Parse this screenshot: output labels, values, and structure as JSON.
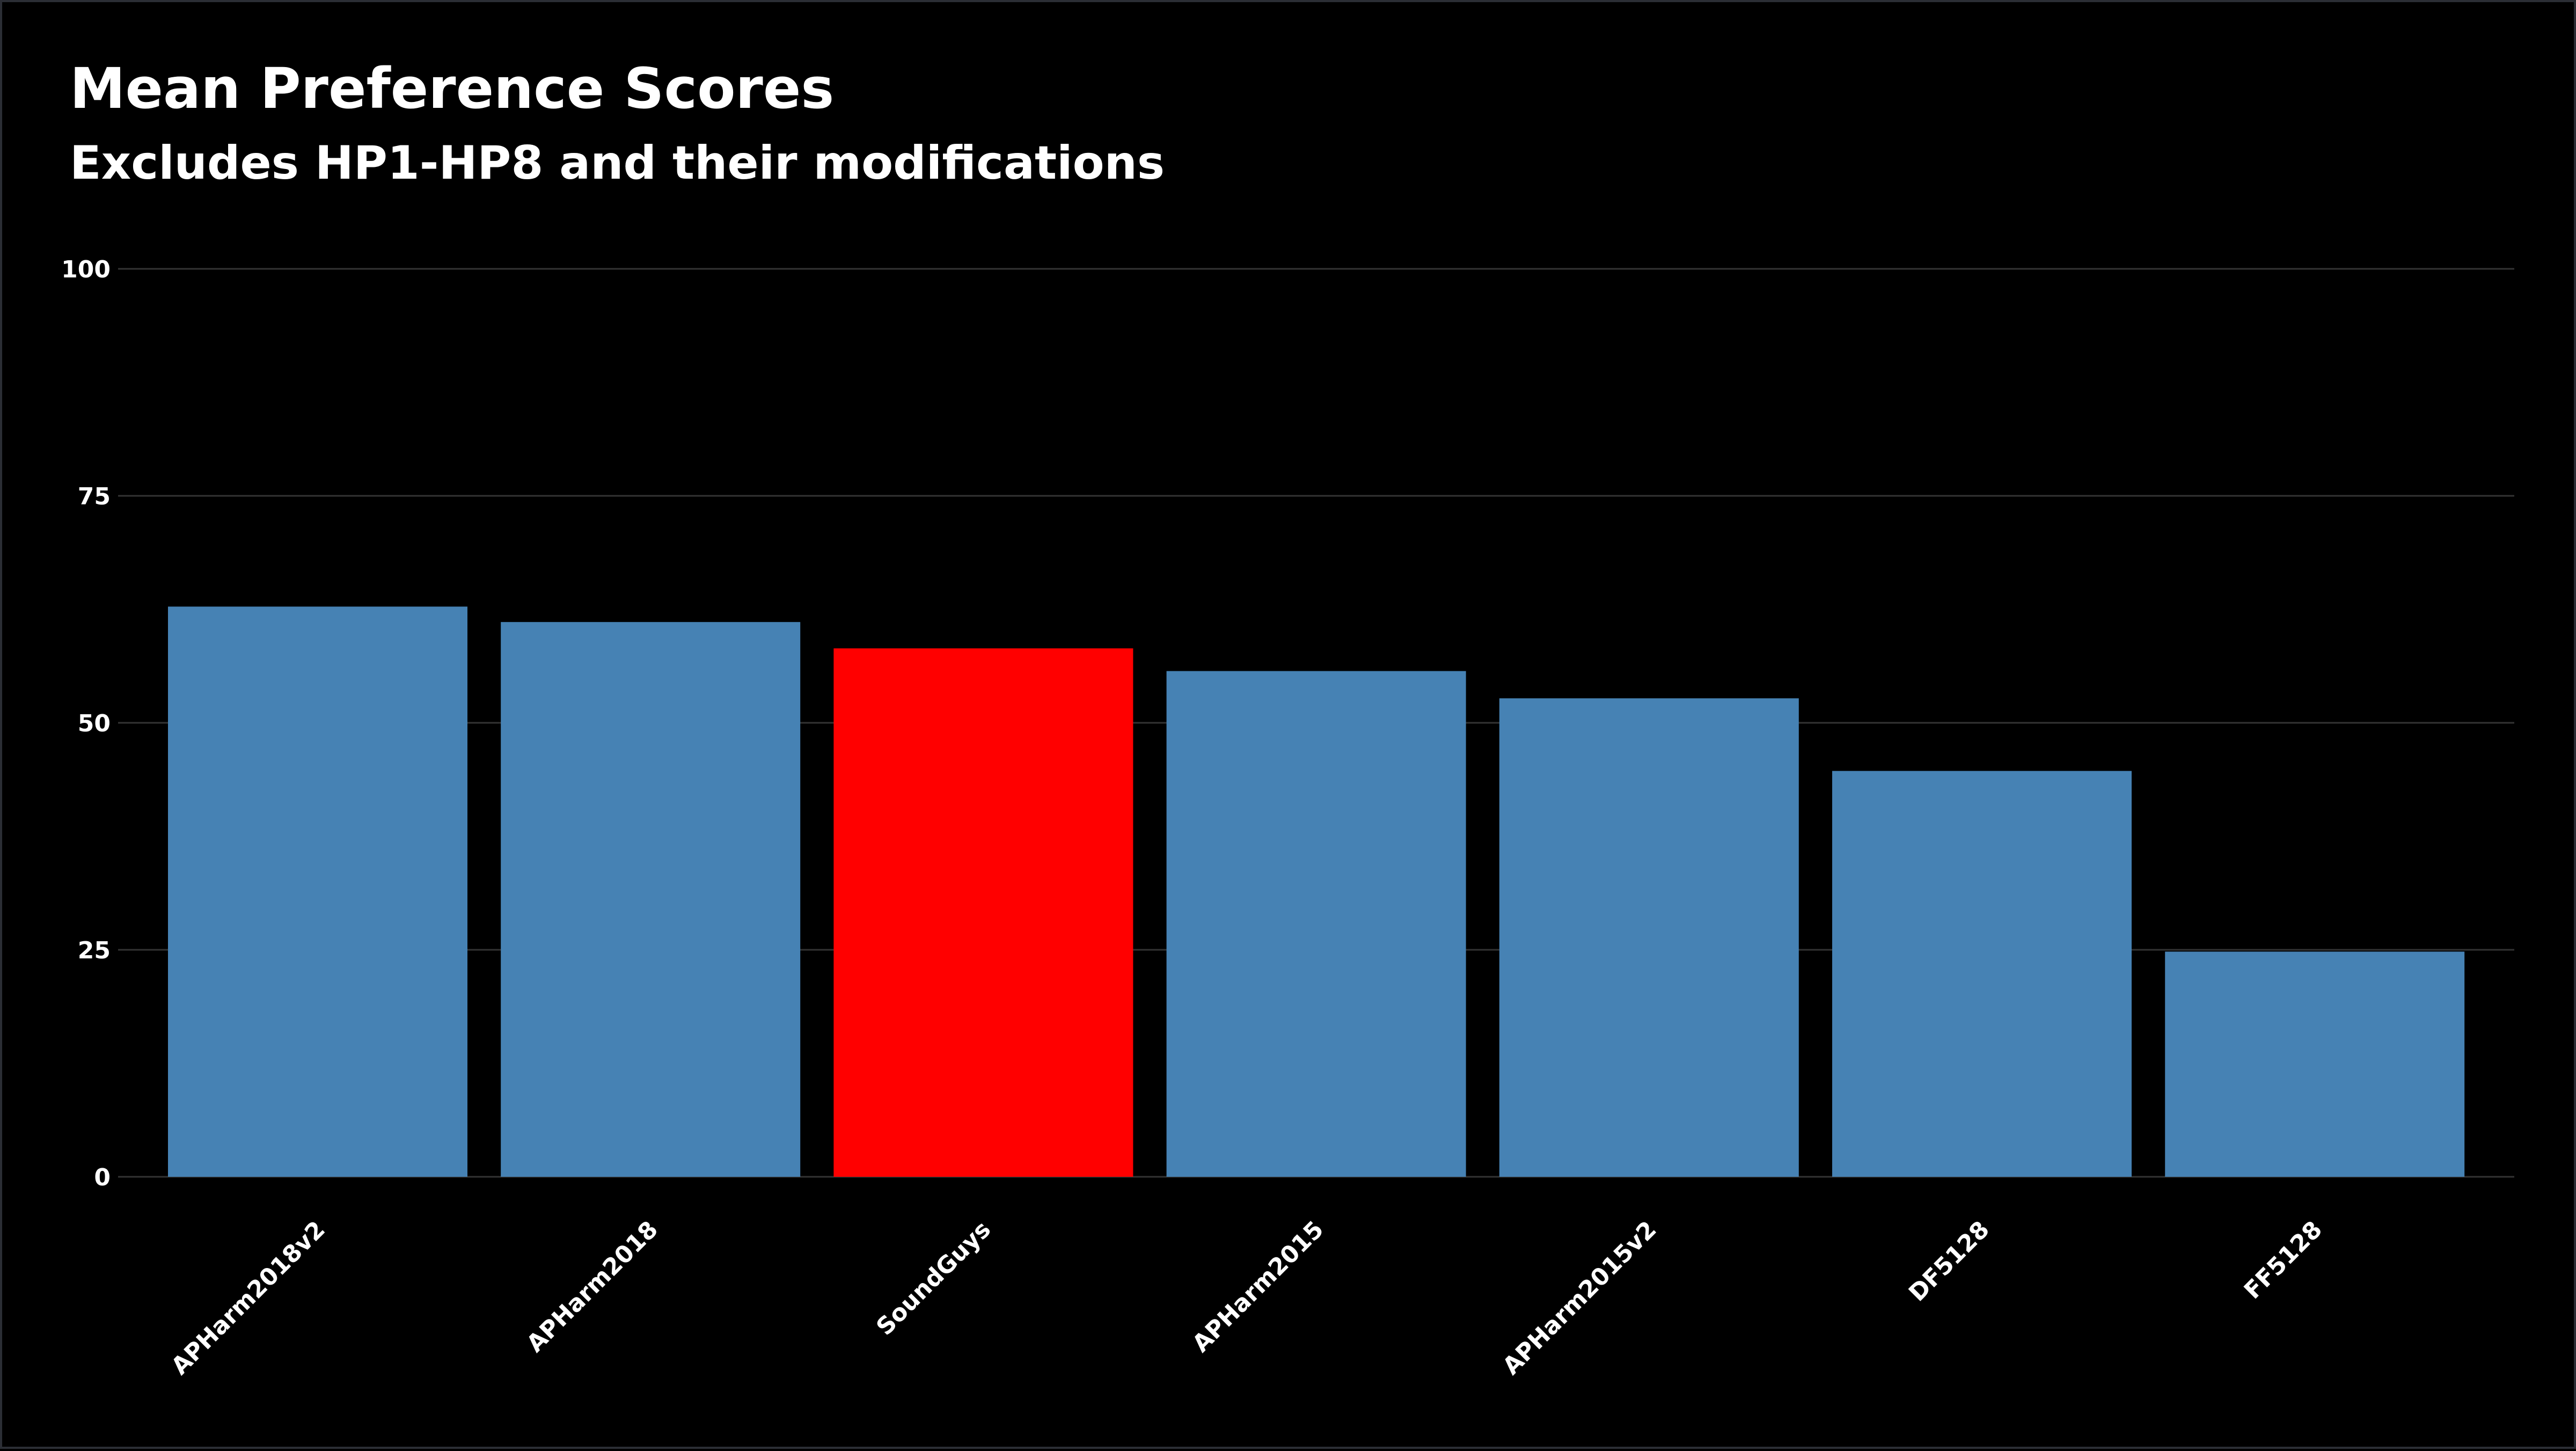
{
  "chart_data": {
    "type": "bar",
    "title": "Mean Preference Scores",
    "subtitle": "Excludes HP1-HP8 and their modifications",
    "xlabel": "",
    "ylabel": "",
    "ylim": [
      0,
      100
    ],
    "yticks": [
      0,
      25,
      50,
      75,
      100
    ],
    "grid": true,
    "legend": "none",
    "categories": [
      "APHarm2018v2",
      "APHarm2018",
      "SoundGuys",
      "APHarm2015",
      "APHarm2015v2",
      "DF5128",
      "FF5128"
    ],
    "values": [
      62.8,
      61.1,
      58.2,
      55.7,
      52.7,
      44.7,
      24.8
    ],
    "highlight": "SoundGuys",
    "colors": {
      "default": "#4682B4",
      "highlight": "#FF0000",
      "background": "#000000",
      "text": "#FFFFFF",
      "grid": "#333333"
    }
  }
}
